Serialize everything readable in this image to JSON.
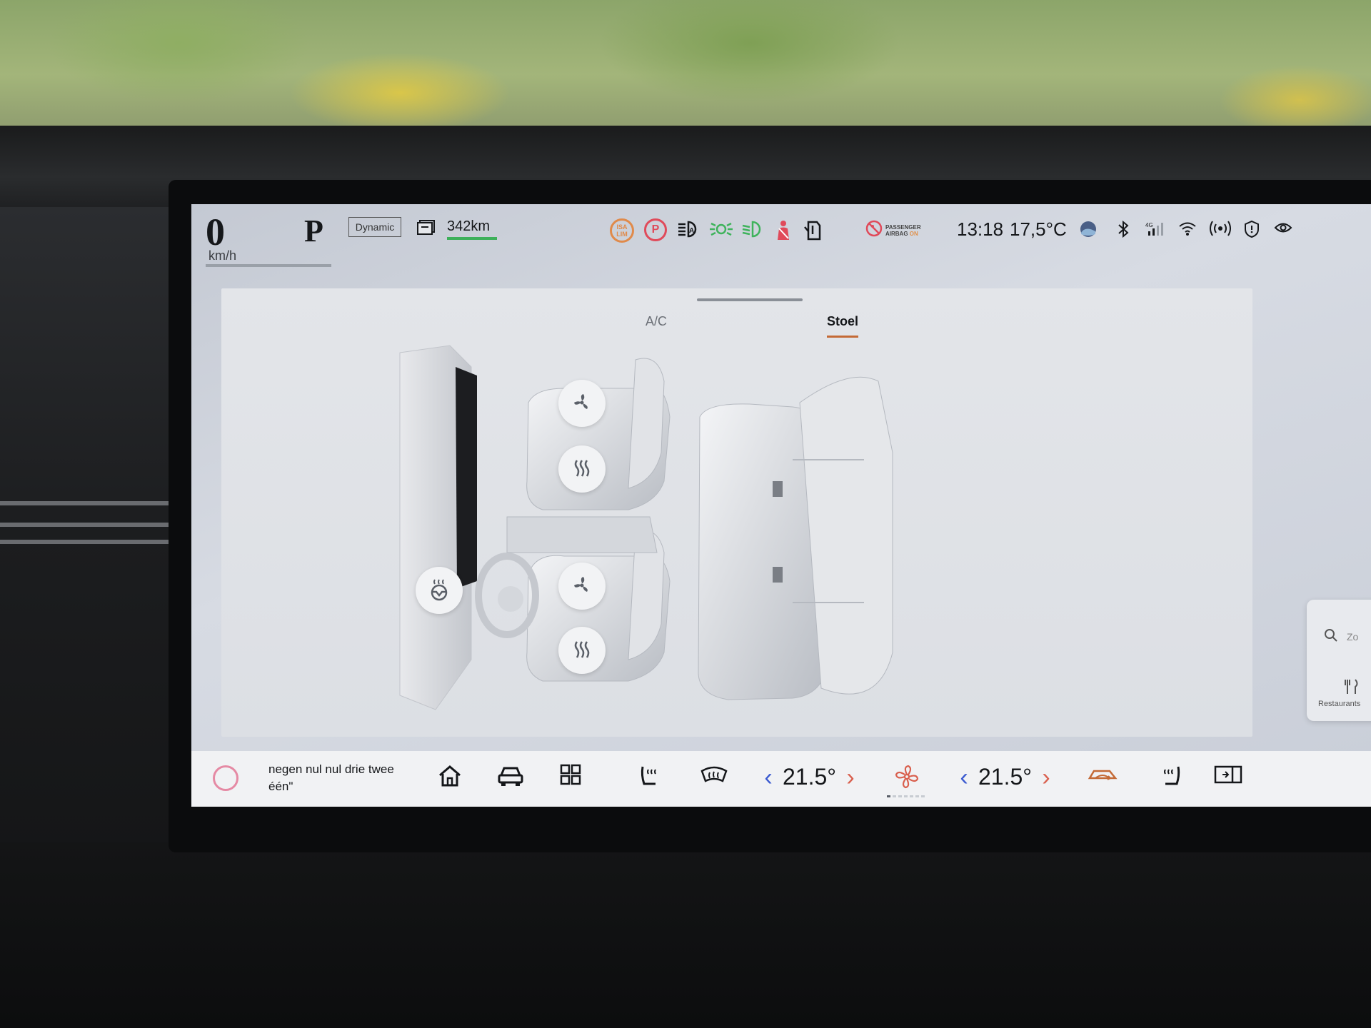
{
  "status": {
    "speed": "0",
    "speed_unit": "km/h",
    "gear": "P",
    "drive_mode": "Dynamic",
    "range": "342km",
    "isa_line1": "ISA",
    "isa_line2": "LIM",
    "parking_brake": "P",
    "airbag_line1": "PASSENGER",
    "airbag_line2": "AIRBAG",
    "airbag_state": "ON",
    "time": "13:18",
    "outside_temp": "17,5°C",
    "network": "4G"
  },
  "climate_panel": {
    "tabs": [
      {
        "label": "A/C",
        "active": false
      },
      {
        "label": "Stoel",
        "active": true
      }
    ]
  },
  "search_card": {
    "placeholder": "Zo",
    "shortcut_label": "Restaurants"
  },
  "dock": {
    "voice_text": "negen nul nul drie twee één\"",
    "driver_temp": "21.5°",
    "passenger_temp": "21.5°",
    "fan_level": 1,
    "fan_level_max": 7
  },
  "colors": {
    "accent_orange": "#c46a36",
    "temp_down_blue": "#3a5ad0",
    "temp_up_red": "#d9604e",
    "range_green": "#3db05a",
    "warning_red": "#e04a5a",
    "warning_orange": "#e08a4a"
  },
  "icons": [
    "battery-icon",
    "isa-limit-icon",
    "parking-brake-icon",
    "auto-headlight-icon",
    "parking-light-icon",
    "low-beam-icon",
    "seatbelt-icon",
    "door-open-icon",
    "passenger-airbag-icon",
    "weather-icon",
    "bluetooth-icon",
    "cellular-icon",
    "wifi-icon",
    "connectivity-icon",
    "shield-icon",
    "eye-icon",
    "seat-ventilation-icon",
    "seat-heating-icon",
    "steering-wheel-heat-icon",
    "home-icon",
    "car-icon",
    "apps-grid-icon",
    "defrost-icon",
    "fan-icon",
    "recirculation-icon",
    "split-screen-icon",
    "search-icon",
    "restaurant-icon"
  ]
}
